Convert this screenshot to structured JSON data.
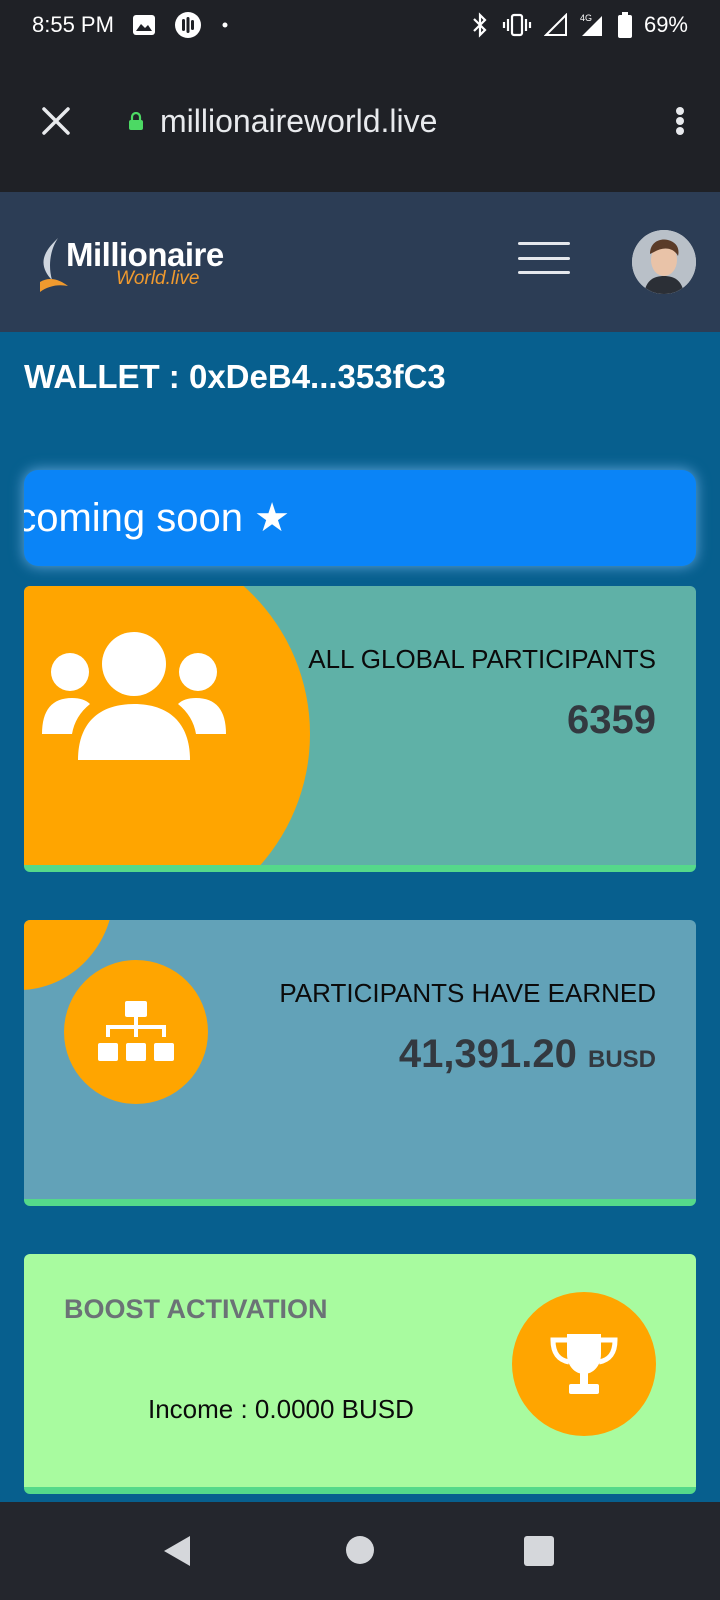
{
  "status_bar": {
    "time": "8:55 PM",
    "battery": "69%",
    "network": "4G",
    "icons": [
      "image-icon",
      "podcast-icon",
      "dot-icon",
      "bluetooth-icon",
      "vibrate-icon",
      "signal-icon",
      "signal-4g-icon",
      "battery-icon"
    ]
  },
  "browser": {
    "url": "millionaireworld.live",
    "close_icon": "close-icon",
    "lock_icon": "lock-icon",
    "menu_icon": "more-vert-icon"
  },
  "header": {
    "logo_main": "Millionaire",
    "logo_sub": "World.live",
    "menu_icon": "hamburger-icon"
  },
  "wallet": {
    "text": "WALLET : 0xDeB4...353fC3"
  },
  "marquee": {
    "text": "t coming soon ★"
  },
  "cards": {
    "participants": {
      "title": "ALL GLOBAL PARTICIPANTS",
      "value": "6359",
      "icon": "users-icon"
    },
    "earned": {
      "title": "PARTICIPANTS HAVE EARNED",
      "value": "41,391.20",
      "unit": "BUSD",
      "icon": "sitemap-icon"
    },
    "boost": {
      "title": "BOOST ACTIVATION",
      "income": "Income : 0.0000 BUSD",
      "icon": "trophy-icon"
    }
  },
  "colors": {
    "header_bg": "#2c3d55",
    "content_bg": "#075f8e",
    "accent_orange": "#ffa500",
    "marquee_bg": "#0a84f7",
    "card1_bg": "#5fb1a7",
    "card2_bg": "#62a2b8",
    "card3_bg": "#a8fb9f",
    "card_border": "#55d98a"
  },
  "nav_bar": {
    "icons": [
      "back-icon",
      "home-icon",
      "recents-icon"
    ]
  }
}
